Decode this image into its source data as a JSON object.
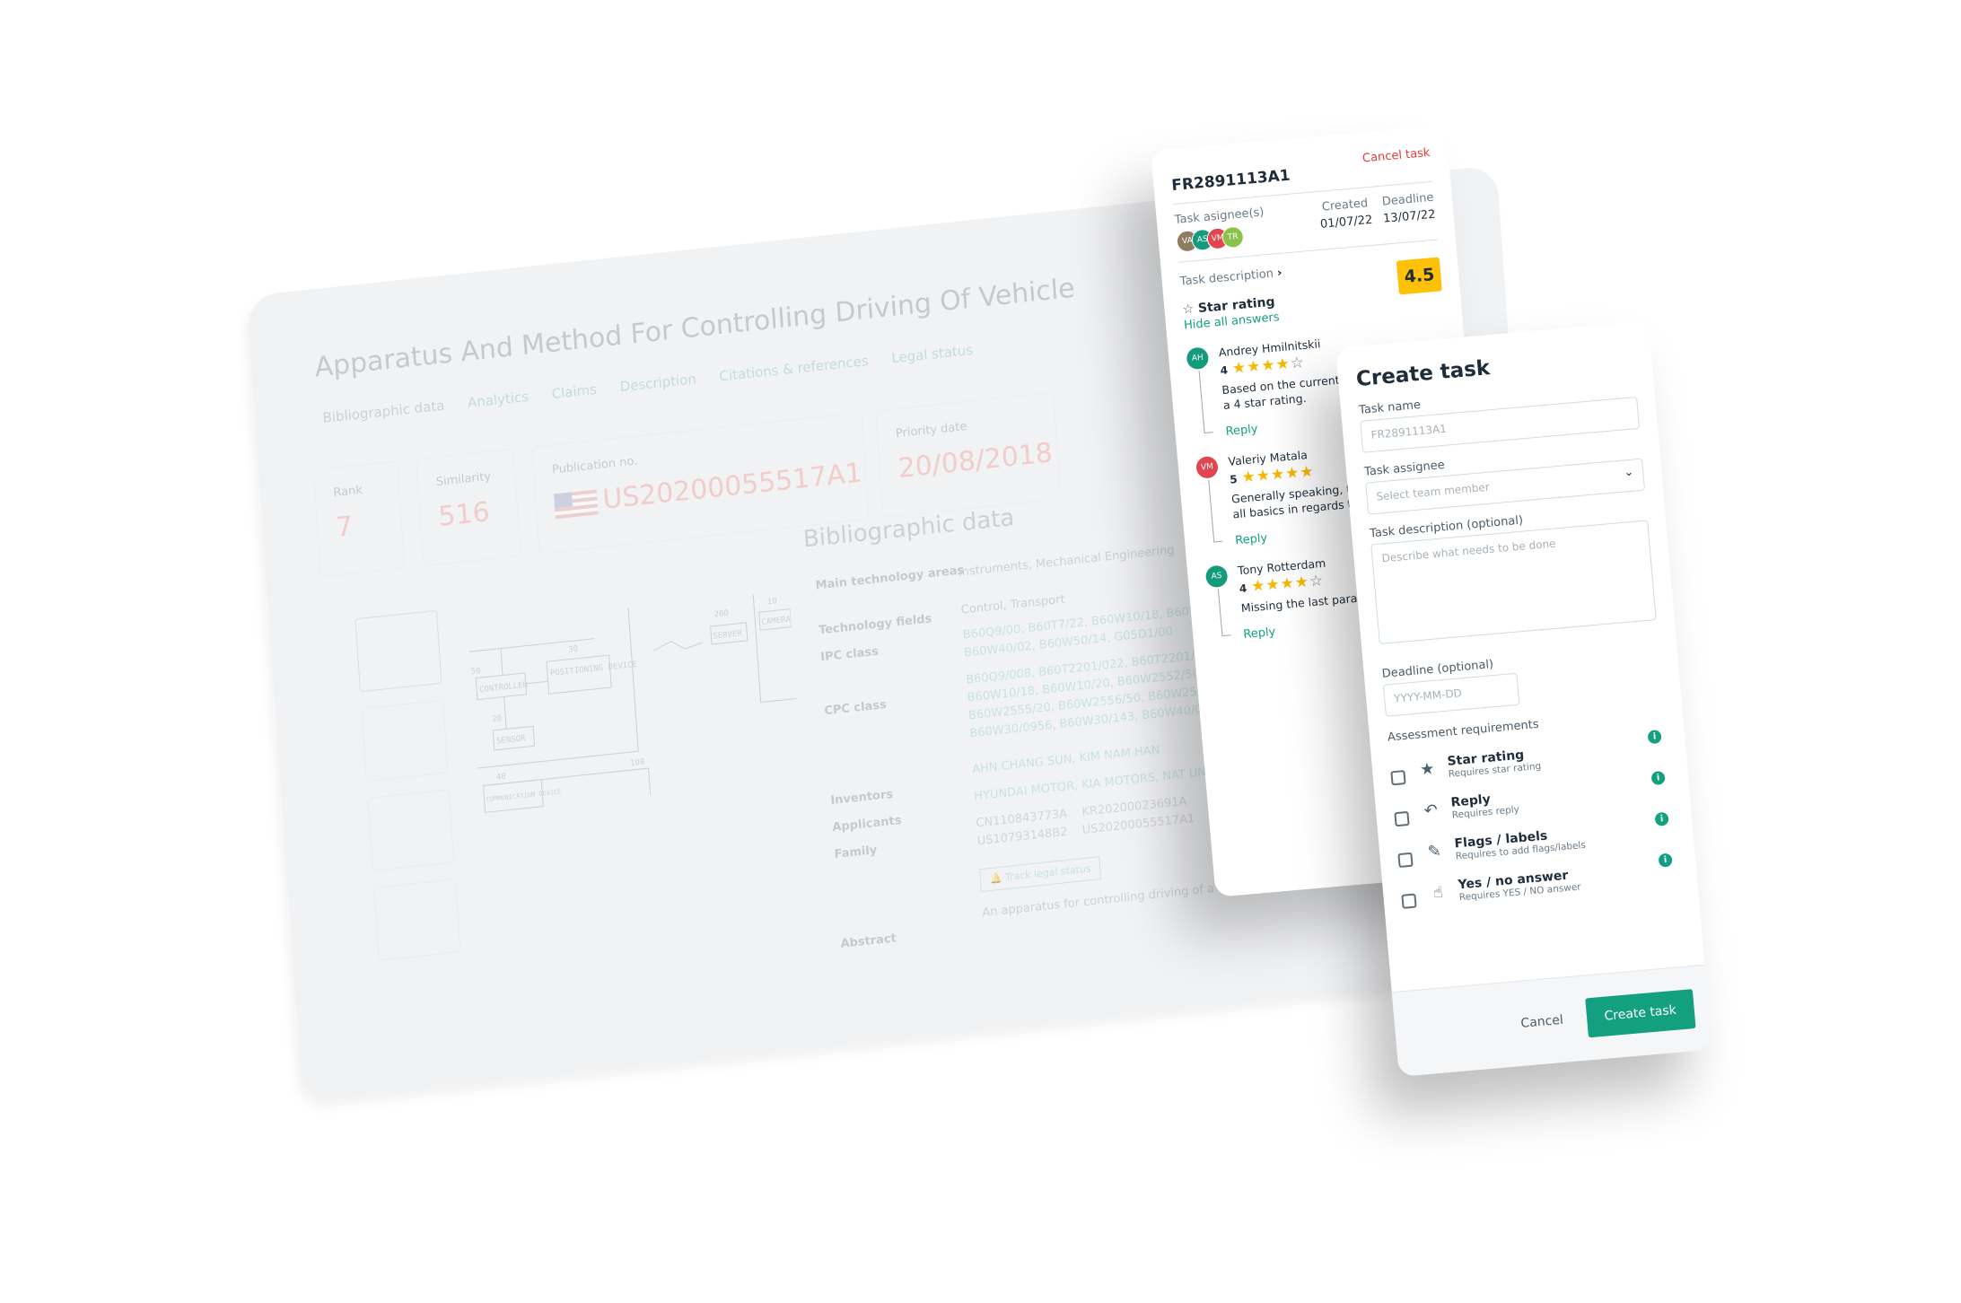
{
  "patent": {
    "title": "Apparatus And Method For Controlling Driving Of Vehicle",
    "tabs": [
      "Bibliographic data",
      "Analytics",
      "Claims",
      "Description",
      "Citations & references",
      "Legal status"
    ],
    "rank_label": "Rank",
    "rank": "7",
    "similarity_label": "Similarity",
    "similarity": "516",
    "publication_label": "Publication no.",
    "publication": "US20200055517A1",
    "priority_label": "Priority date",
    "priority": "20/08/2018",
    "diagram_labels": {
      "controller": "CONTROLLER",
      "positioning": "POSITIONING DEVICE",
      "sensor": "SENSOR",
      "server": "SERVER",
      "camera": "CAMERA",
      "communication": "COMMUNICATION DEVICE",
      "n50": "50",
      "n30": "30",
      "n20": "20",
      "n200": "200",
      "n10": "10",
      "n40": "40",
      "n100": "100"
    },
    "bib_heading": "Bibliographic data",
    "fields": [
      {
        "k": "Main technology areas",
        "v": "Instruments, Mechanical Engineering"
      },
      {
        "k": "Technology fields",
        "v": "Control, Transport"
      },
      {
        "k": "IPC class",
        "v": "B60Q9/00, B60T7/22, B60W10/18, B60W10/20, B60W30/14, B60W40/02, B60W50/14, G05D1/00"
      },
      {
        "k": "CPC class",
        "v": "B60Q9/008, B60T2201/022, B60T2201/024, B60T8/17558, B60W10/18, B60W10/20, B60W2552/50, B60W2554/00, B60W2555/20, B60W2556/50, B60W2556/60, B60W2720/10, B60W30/0956, B60W30/143, B60W40/02"
      },
      {
        "k": "Inventors",
        "v": "AHN CHANG SUN, KIM NAM HAN"
      },
      {
        "k": "Applicants",
        "v": "HYUNDAI MOTOR, KIA MOTORS, NAT UNIV PUSAN"
      },
      {
        "k": "Family",
        "v": ""
      },
      {
        "k": "Abstract",
        "v": "An apparatus for controlling driving of a vehicle is provided. The apparatus includ"
      }
    ],
    "family": [
      "CN110843773A",
      "KR20200023691A",
      "US10793148B2",
      "US20200055517A1"
    ],
    "track_label": "Track legal status"
  },
  "task": {
    "id": "FR2891113A1",
    "cancel": "Cancel task",
    "assignees_label": "Task asignee(s)",
    "assignees": [
      {
        "i": "VA",
        "c": "#8d7b62"
      },
      {
        "i": "AS",
        "c": "#139b7b"
      },
      {
        "i": "VM",
        "c": "#e0464f"
      },
      {
        "i": "TR",
        "c": "#8bc34a"
      }
    ],
    "created_label": "Created",
    "created": "01/07/22",
    "deadline_label": "Deadline",
    "deadline": "13/07/22",
    "description_label": "Task description",
    "section": "Star rating",
    "score": "4.5",
    "hide": "Hide all answers",
    "comments": [
      {
        "i": "AH",
        "c": "#139b7b",
        "name": "Andrey Hmilnitskii",
        "rating": 4,
        "text": "Based on the current r\na 4 star rating.",
        "reply": "Reply"
      },
      {
        "i": "VM",
        "c": "#e0464f",
        "name": "Valeriy Matala",
        "rating": 5,
        "text": "Generally speaking, the\nall basics in regards to",
        "reply": "Reply"
      },
      {
        "i": "AS",
        "c": "#139b7b",
        "name": "Tony Rotterdam",
        "rating": 4,
        "text": "Missing the last paragr",
        "reply": "Reply"
      }
    ]
  },
  "create": {
    "title": "Create task",
    "name_label": "Task name",
    "name_placeholder": "FR2891113A1",
    "assignee_label": "Task assignee",
    "assignee_placeholder": "Select team member",
    "desc_label": "Task description (optional)",
    "desc_placeholder": "Describe what needs to be done",
    "deadline_label": "Deadline (optional)",
    "deadline_placeholder": "YYYY-MM-DD",
    "req_label": "Assessment requirements",
    "requirements": [
      {
        "title": "Star rating",
        "sub": "Requires star rating",
        "icon": "star-icon"
      },
      {
        "title": "Reply",
        "sub": "Requires reply",
        "icon": "reply-icon"
      },
      {
        "title": "Flags / labels",
        "sub": "Requires to add flags/labels",
        "icon": "marker-icon"
      },
      {
        "title": "Yes / no answer",
        "sub": "Requires YES / NO answer",
        "icon": "hand-check-icon"
      }
    ],
    "cancel": "Cancel",
    "submit": "Create task"
  },
  "colors": {
    "accent": "#12a07e",
    "danger": "#e53935",
    "score": "#ffc107"
  }
}
